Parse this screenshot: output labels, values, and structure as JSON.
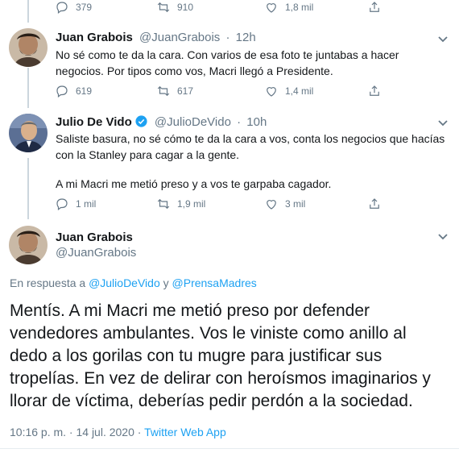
{
  "top_tweet": {
    "replies": "379",
    "retweets": "910",
    "likes": "1,8 mil"
  },
  "reply_1": {
    "name": "Juan Grabois",
    "handle": "@JuanGrabois",
    "separator": "·",
    "time": "12h",
    "text_line_1": "No sé como te da la cara. Con varios de esa foto te juntabas a hacer",
    "text_line_2": "negocios. Por tipos como vos, Macri llegó a Presidente.",
    "replies": "619",
    "retweets": "617",
    "likes": "1,4 mil"
  },
  "reply_2": {
    "name": "Julio De Vido",
    "handle": "@JulioDeVido",
    "separator": "·",
    "time": "10h",
    "text_line_1": "Saliste basura, no sé cómo te da la cara a vos, conta los negocios que hacías",
    "text_line_2": "con la Stanley para cagar a la gente.",
    "text_line_3": "A mi Macri me metió preso y a vos te garpaba cagador.",
    "replies": "1 mil",
    "retweets": "1,9 mil",
    "likes": "3 mil"
  },
  "main_tweet": {
    "name": "Juan Grabois",
    "handle": "@JuanGrabois",
    "reply_prefix": "En respuesta a",
    "reply_user_1": "@JulioDeVido",
    "reply_conj": "y",
    "reply_user_2": "@PrensaMadres",
    "text_line_1": "Mentís. A mi Macri me metió preso por defender",
    "text_line_2": "vendedores ambulantes. Vos le viniste como anillo al",
    "text_line_3": "dedo a los gorilas con tu mugre para justificar sus",
    "text_line_4": "tropelías. En vez de delirar con heroísmos imaginarios y",
    "text_line_5": "llorar de víctima, deberías pedir perdón a la sociedad.",
    "timestamp": "10:16 p. m. · 14 jul. 2020",
    "meta_sep": "·",
    "client": "Twitter Web App"
  },
  "colors": {
    "accent": "#1da1f2",
    "muted": "#657786",
    "text": "#14171a",
    "thread_line": "#ccd6dd"
  },
  "icons": [
    "reply-icon",
    "retweet-icon",
    "like-icon",
    "share-icon",
    "chevron-down-icon",
    "verified-badge-icon"
  ]
}
